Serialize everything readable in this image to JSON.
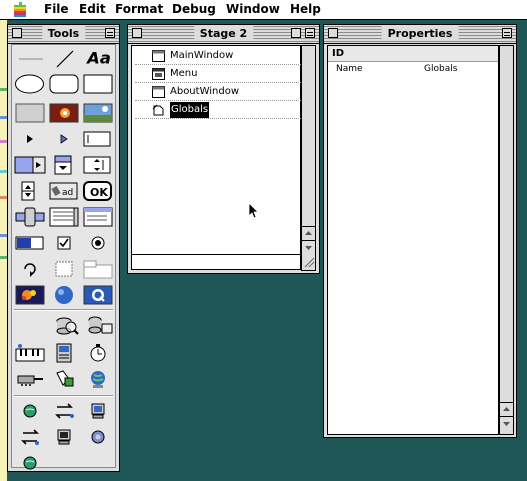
{
  "menubar": {
    "items": [
      "File",
      "Edit",
      "Format",
      "Debug",
      "Window",
      "Help"
    ]
  },
  "tools_window": {
    "title": "Tools",
    "text_tool_glyph": "Aa",
    "ok_button_label": "OK",
    "field_label": "ad"
  },
  "stage_window": {
    "title": "Stage 2",
    "items": [
      {
        "label": "MainWindow",
        "icon": "window-icon",
        "selected": false
      },
      {
        "label": "Menu",
        "icon": "menu-icon",
        "selected": false
      },
      {
        "label": "AboutWindow",
        "icon": "window-icon",
        "selected": false
      },
      {
        "label": "Globals",
        "icon": "globals-icon",
        "selected": true
      }
    ]
  },
  "properties_window": {
    "title": "Properties",
    "header": "ID",
    "rows": [
      {
        "name": "Name",
        "value": "Globals"
      }
    ]
  },
  "colors": {
    "desktop": "#1f5656",
    "window_bg": "#dddddd",
    "selection": "#000000"
  }
}
